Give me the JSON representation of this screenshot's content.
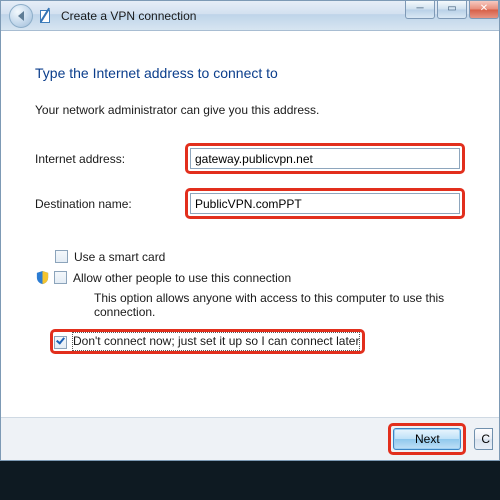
{
  "titlebar": {
    "title": "Create a VPN connection"
  },
  "content": {
    "heading": "Type the Internet address to connect to",
    "subtext": "Your network administrator can give you this address.",
    "field_internet_label": "Internet address:",
    "field_internet_value": "gateway.publicvpn.net",
    "field_destination_label": "Destination name:",
    "field_destination_value": "PublicVPN.comPPT",
    "opt_smartcard_label": "Use a smart card",
    "opt_allow_label": "Allow other people to use this connection",
    "opt_allow_sub": "This option allows anyone with access to this computer to use this connection.",
    "opt_dontconnect_label": "Don't connect now; just set it up so I can connect later"
  },
  "buttons": {
    "next": "Next",
    "cancel": "C"
  }
}
